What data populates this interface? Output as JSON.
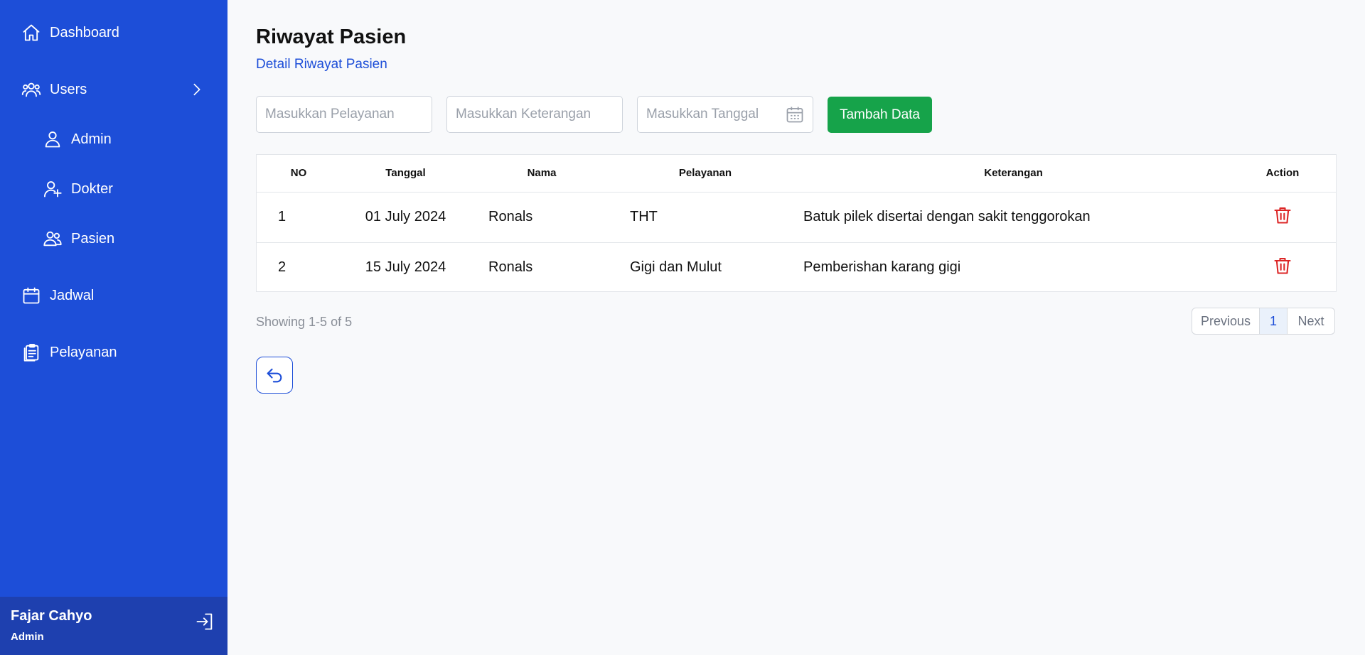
{
  "sidebar": {
    "items": [
      {
        "label": "Dashboard",
        "icon": "home-icon"
      },
      {
        "label": "Users",
        "icon": "users-icon"
      },
      {
        "label": "Admin",
        "icon": "user-icon"
      },
      {
        "label": "Dokter",
        "icon": "user-plus-icon"
      },
      {
        "label": "Pasien",
        "icon": "users-icon"
      },
      {
        "label": "Jadwal",
        "icon": "calendar-icon"
      },
      {
        "label": "Pelayanan",
        "icon": "clipboard-icon"
      }
    ],
    "user": {
      "name": "Fajar Cahyo",
      "role": "Admin"
    }
  },
  "header": {
    "title": "Riwayat Pasien",
    "subtitle": "Detail Riwayat Pasien"
  },
  "form": {
    "pelayanan_placeholder": "Masukkan Pelayanan",
    "keterangan_placeholder": "Masukkan Keterangan",
    "tanggal_placeholder": "Masukkan Tanggal",
    "add_label": "Tambah Data"
  },
  "table": {
    "headers": [
      "NO",
      "Tanggal",
      "Nama",
      "Pelayanan",
      "Keterangan",
      "Action"
    ],
    "rows": [
      {
        "no": "1",
        "tanggal": "01 July 2024",
        "nama": "Ronals",
        "pelayanan": "THT",
        "keterangan": "Batuk pilek disertai dengan sakit tenggorokan"
      },
      {
        "no": "2",
        "tanggal": "15 July 2024",
        "nama": "Ronals",
        "pelayanan": "Gigi dan Mulut",
        "keterangan": "Pemberishan karang gigi"
      }
    ]
  },
  "pagination": {
    "showing": "Showing 1-5 of 5",
    "previous": "Previous",
    "current": "1",
    "next": "Next"
  },
  "colors": {
    "sidebar": "#1d4ed8",
    "accent": "#1d4ed8",
    "add_button": "#16a34a",
    "delete": "#dc2626"
  }
}
